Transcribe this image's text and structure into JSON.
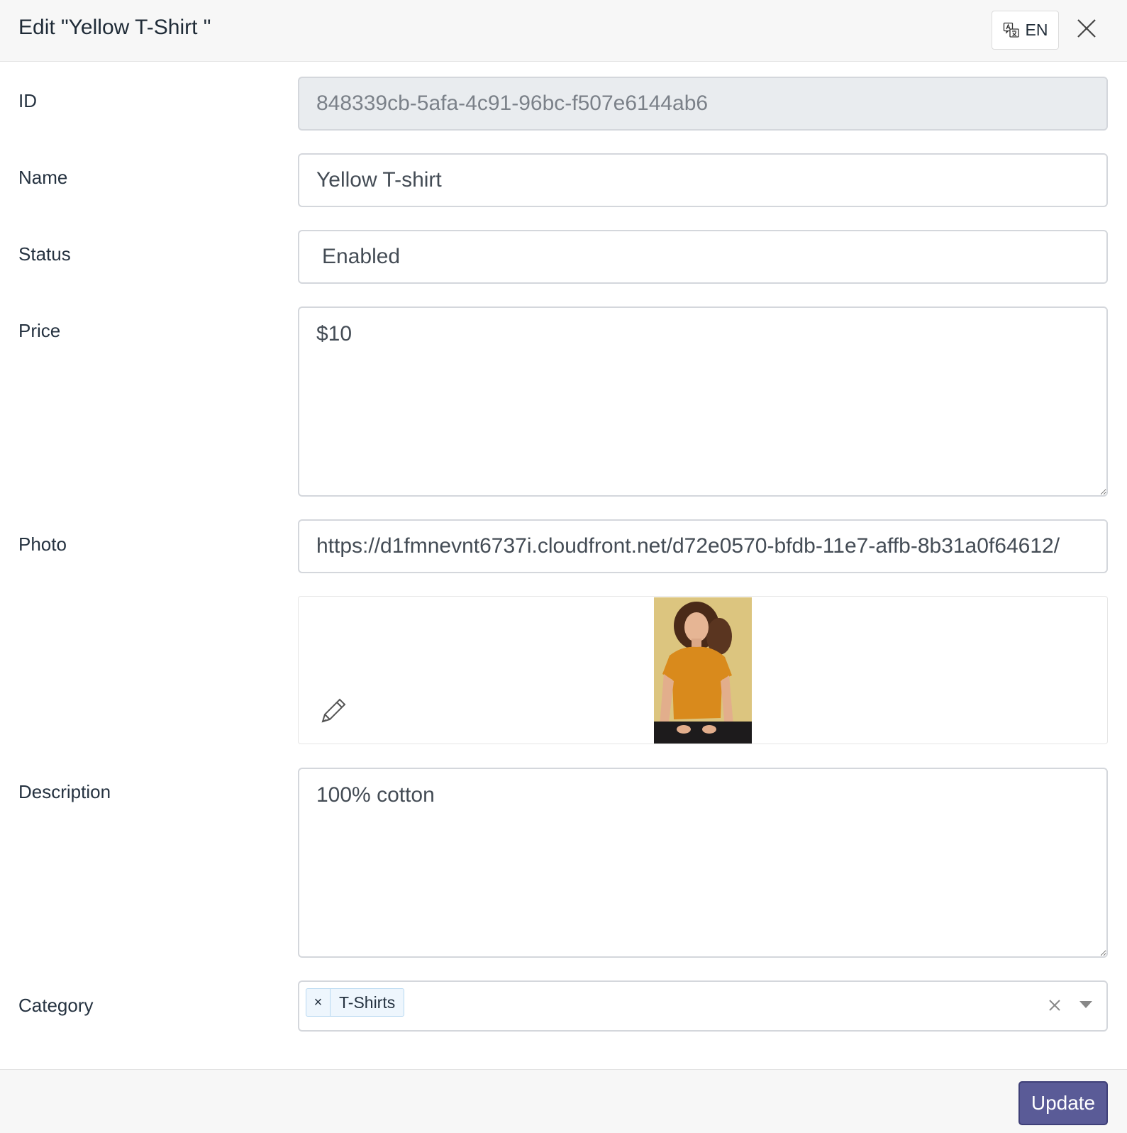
{
  "header": {
    "title": "Edit \"Yellow T-Shirt \"",
    "language_label": "EN",
    "language_icon": "translate-icon",
    "close_icon": "close-icon"
  },
  "form": {
    "id": {
      "label": "ID",
      "value": "848339cb-5afa-4c91-96bc-f507e6144ab6"
    },
    "name": {
      "label": "Name",
      "value": "Yellow T-shirt"
    },
    "status": {
      "label": "Status",
      "value": "Enabled"
    },
    "price": {
      "label": "Price",
      "value": "$10"
    },
    "photo": {
      "label": "Photo",
      "value": "https://d1fmnevnt6737i.cloudfront.net/d72e0570-bfdb-11e7-affb-8b31a0f64612/",
      "edit_icon": "pencil-icon"
    },
    "description": {
      "label": "Description",
      "value": "100% cotton"
    },
    "category": {
      "label": "Category",
      "selected": [
        "T-Shirts"
      ],
      "chip_remove": "×",
      "clear_icon": "clear-icon",
      "dropdown_icon": "chevron-down-icon"
    }
  },
  "footer": {
    "update_label": "Update"
  },
  "colors": {
    "accent": "#5a5b97",
    "header_bg": "#f7f7f7",
    "readonly_bg": "#e9ecef",
    "chip_bg": "#eef6fd"
  }
}
